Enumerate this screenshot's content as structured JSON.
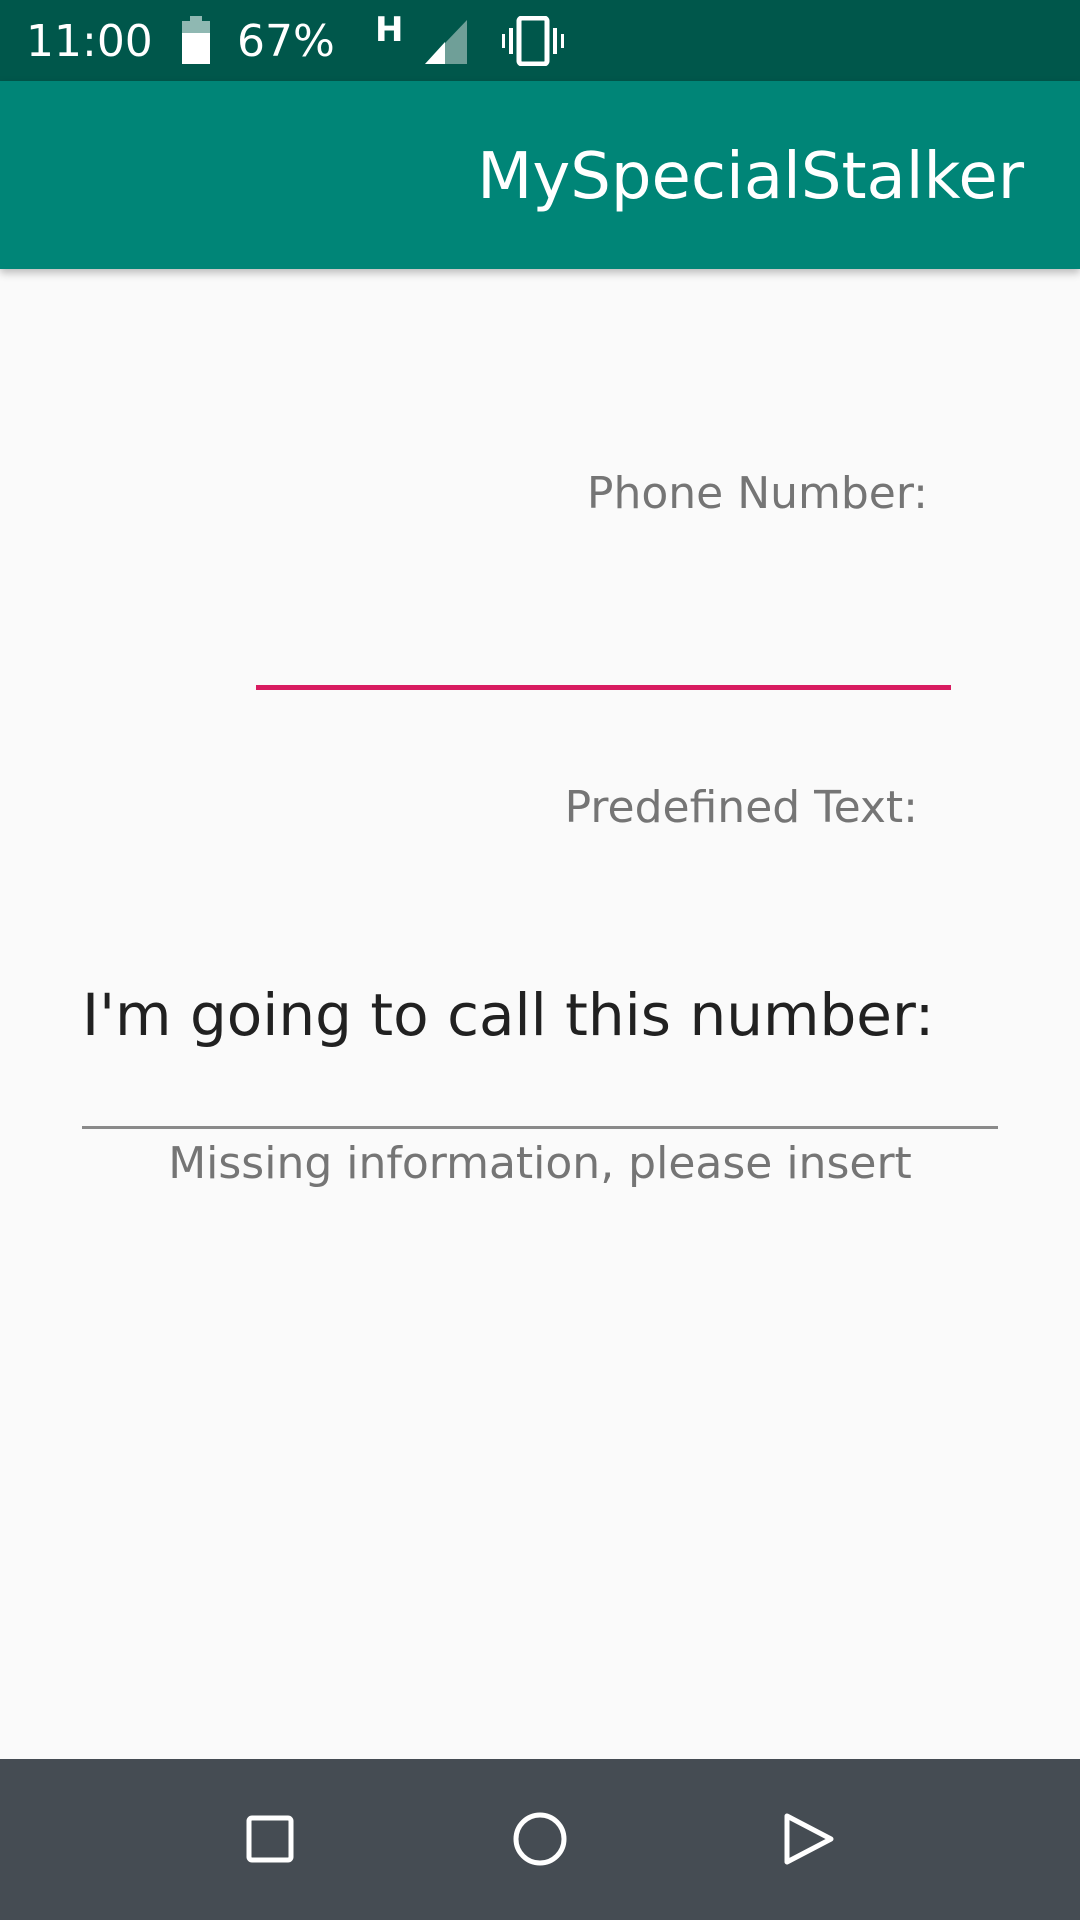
{
  "status_bar": {
    "time": "11:00",
    "battery_percent": "67%",
    "network_type": "H",
    "icons": [
      "battery-icon",
      "signal-icon",
      "vibrate-icon"
    ]
  },
  "app_bar": {
    "title": "MySpecialStalker",
    "color": "#008577"
  },
  "form": {
    "phone_label": "Phone Number:",
    "phone_value": "",
    "predefined_label": "Predefined Text:",
    "call_heading": "I'm going to call this number:",
    "text_value": "",
    "missing_info": "Missing information, please insert"
  },
  "colors": {
    "accent": "#d81b60",
    "status_bar": "#00574b",
    "nav_bar": "#454c53"
  },
  "nav_bar": {
    "buttons": [
      "recents-icon",
      "home-icon",
      "back-icon"
    ]
  }
}
